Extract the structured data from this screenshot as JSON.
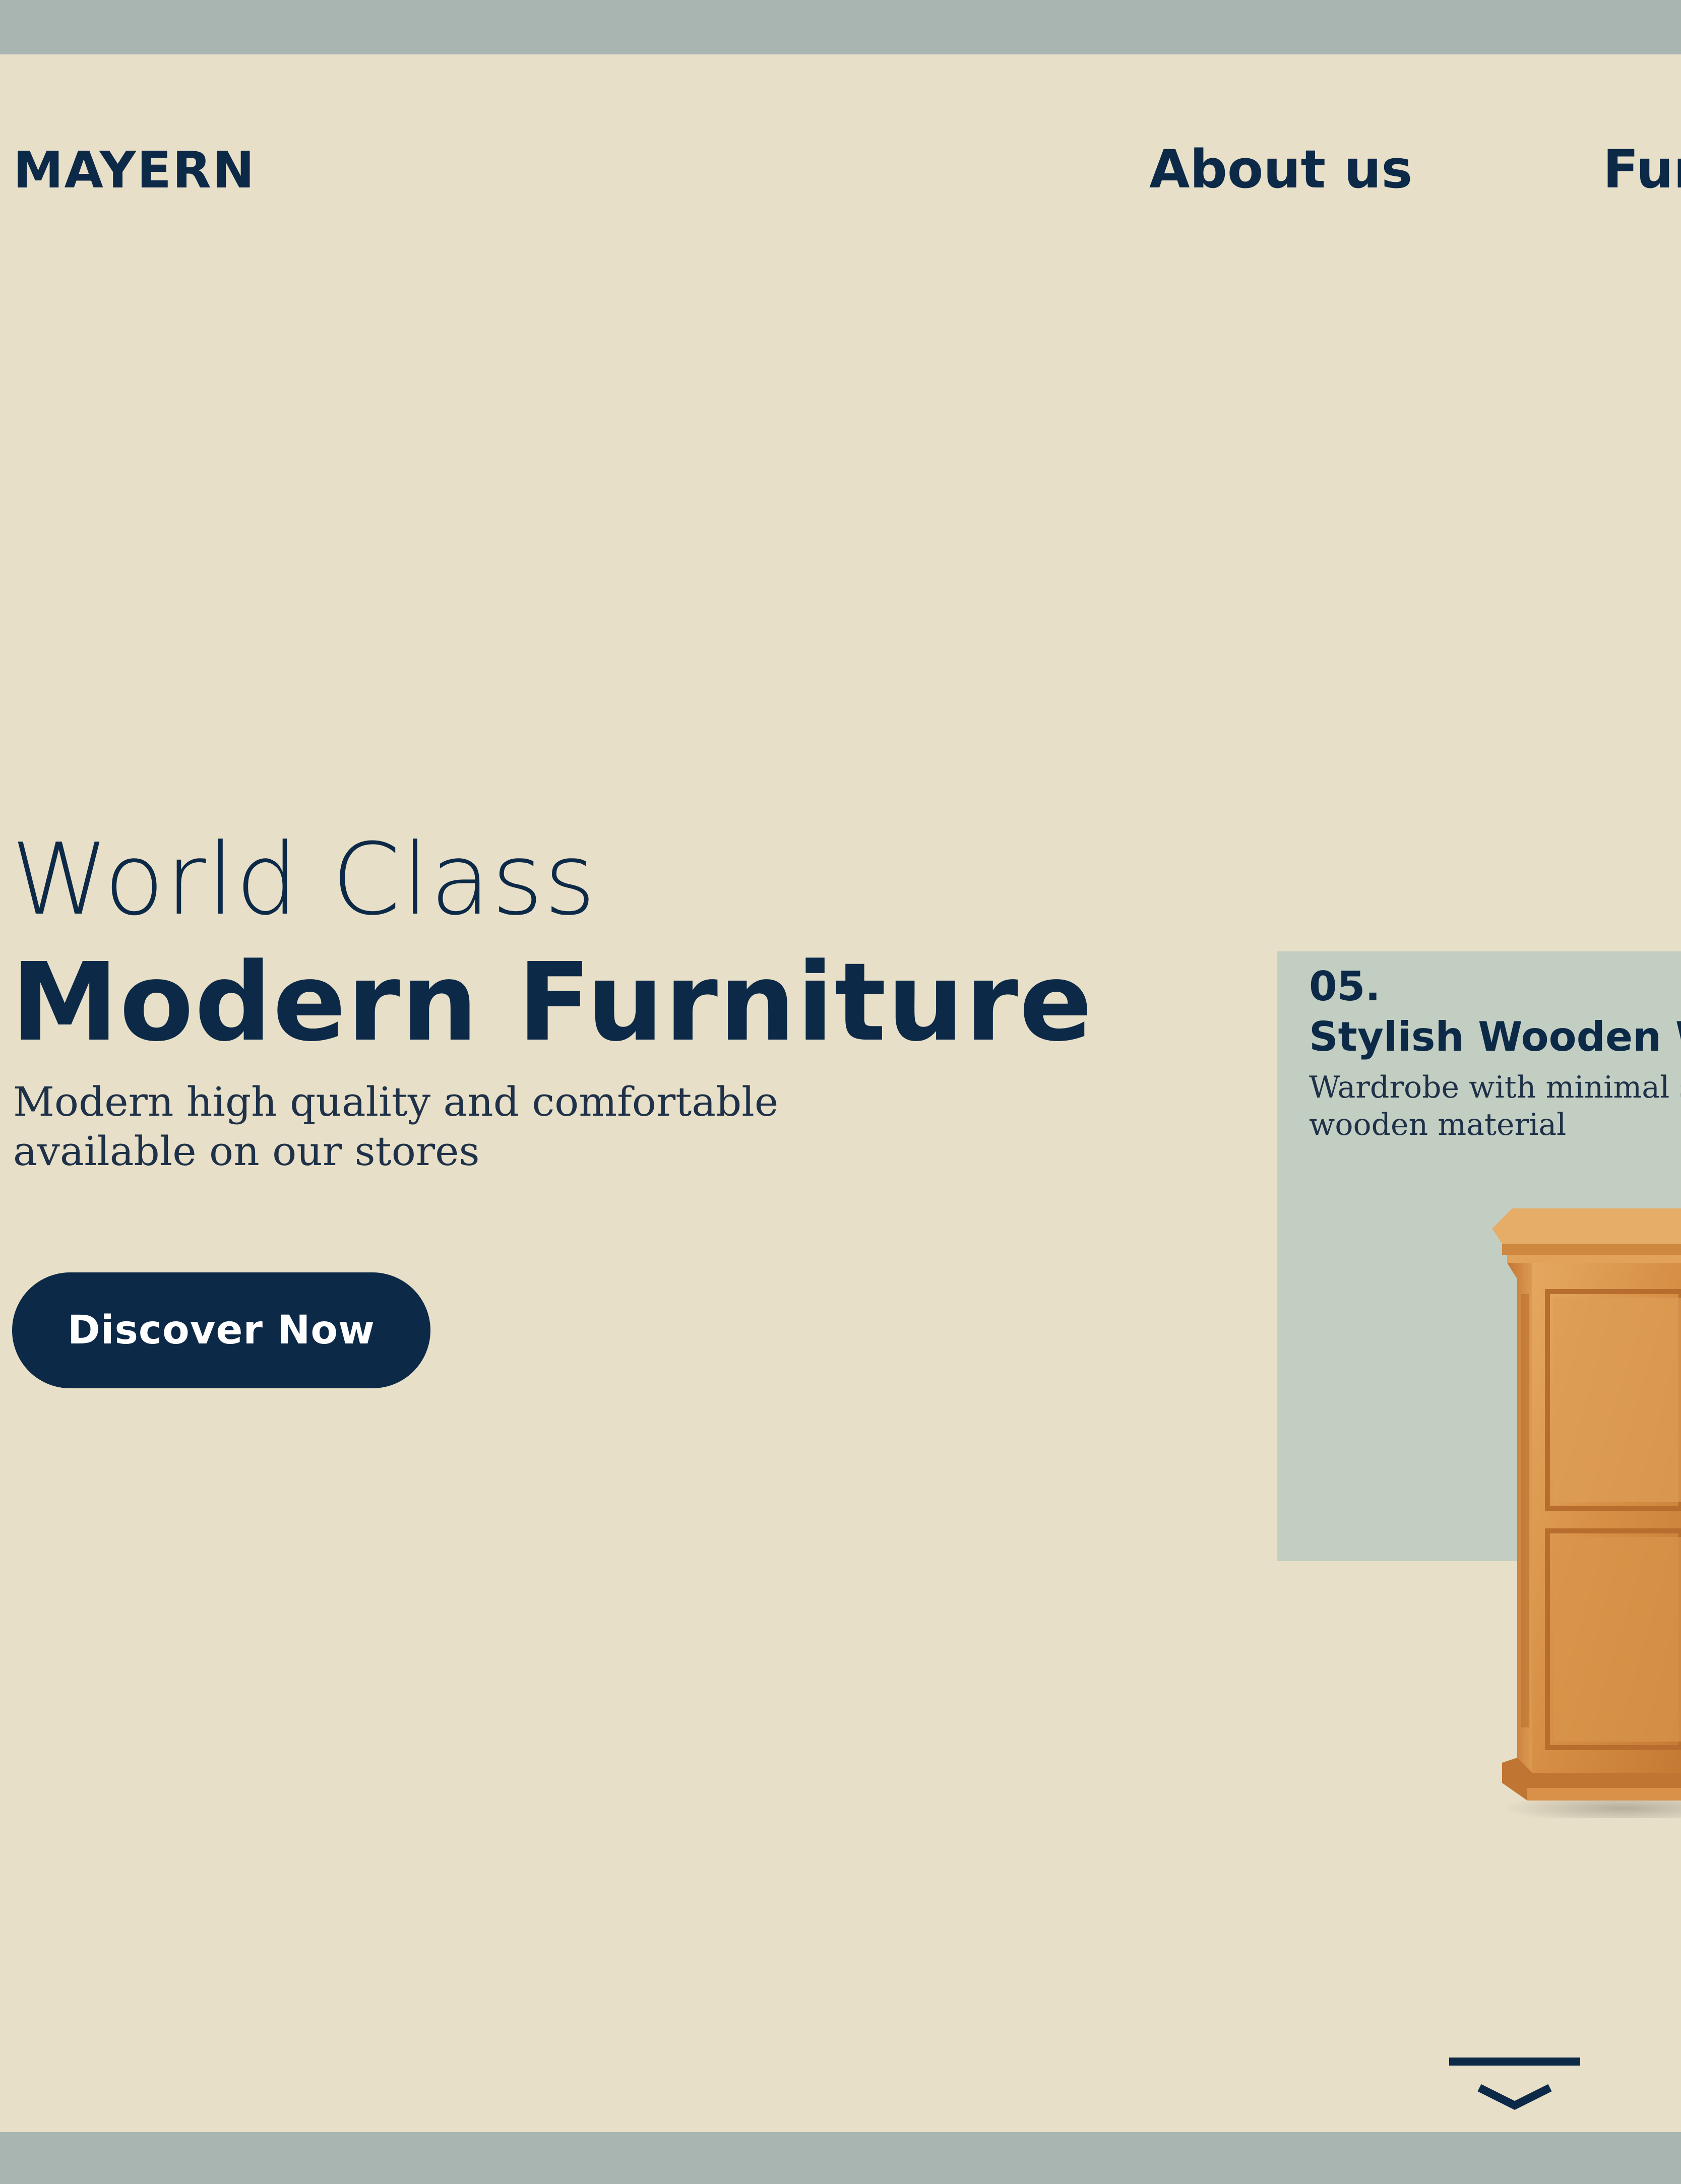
{
  "header": {
    "logo": "MAYERN",
    "nav": [
      {
        "label": "About us"
      },
      {
        "label": "Fur"
      }
    ]
  },
  "hero": {
    "eyebrow": "World Class",
    "title": "Modern Furniture",
    "subtitle_line1": "Modern high quality and comfortable",
    "subtitle_line2": "available on our stores",
    "cta_label": "Discover Now"
  },
  "featured_card": {
    "index": "05.",
    "title": "Stylish Wooden W",
    "description": "Wardrobe with minimal s\nwooden material",
    "image_icon": "wooden-wardrobe"
  },
  "scroll": {
    "icon": "chevron-down-icon"
  },
  "colors": {
    "background": "#e8dfc8",
    "frame": "#a9b5b0",
    "primary": "#0c2a48",
    "card_bg": "#c3cec2",
    "wood": "#d9964a"
  }
}
